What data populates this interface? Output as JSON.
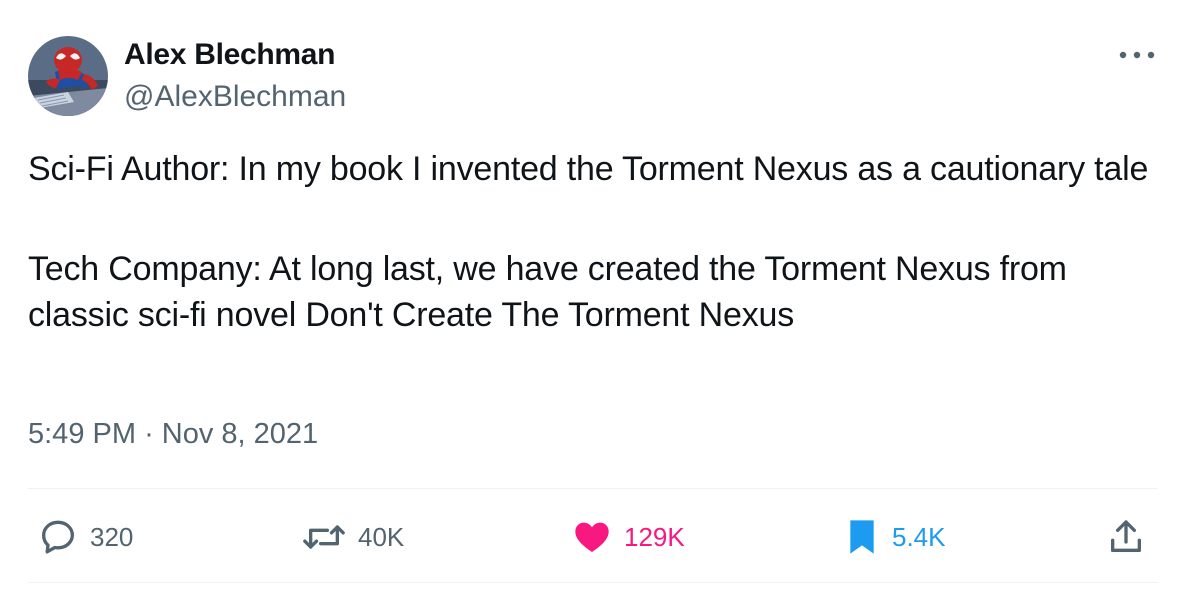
{
  "author": {
    "display_name": "Alex Blechman",
    "handle": "@AlexBlechman",
    "avatar_icon": "spiderman-avatar"
  },
  "tweet": {
    "paragraphs": [
      "Sci-Fi Author: In my book I invented the Torment Nexus as a cautionary tale",
      "Tech Company: At long last, we have created the Torment Nexus from classic sci-fi novel Don't Create The Torment Nexus"
    ],
    "time": "5:49 PM",
    "separator": "·",
    "date": "Nov 8, 2021"
  },
  "actions": {
    "reply": {
      "icon": "reply-icon",
      "count": "320"
    },
    "retweet": {
      "icon": "retweet-icon",
      "count": "40K"
    },
    "like": {
      "icon": "heart-icon",
      "count": "129K",
      "active": true
    },
    "bookmark": {
      "icon": "bookmark-icon",
      "count": "5.4K",
      "active": true
    },
    "share": {
      "icon": "share-icon"
    }
  },
  "colors": {
    "text_primary": "#0f1419",
    "text_secondary": "#536471",
    "like_active": "#f91880",
    "bookmark_active": "#1d9bf0",
    "divider": "#eff3f4"
  }
}
